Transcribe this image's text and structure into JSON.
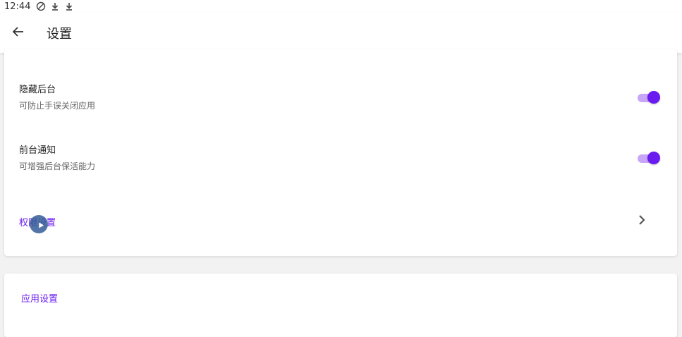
{
  "status_bar": {
    "time": "12:44",
    "icons": [
      "no-sync-icon",
      "download-icon",
      "download-icon"
    ]
  },
  "app_bar": {
    "title": "设置",
    "back_icon": "arrow-back-icon"
  },
  "settings": {
    "hide_background": {
      "title": "隐藏后台",
      "subtitle": "可防止手误关闭应用",
      "enabled": true
    },
    "foreground_notification": {
      "title": "前台通知",
      "subtitle": "可增强后台保活能力",
      "enabled": true
    },
    "permission_settings": {
      "label": "权限设置"
    }
  },
  "app_settings_section": {
    "label": "应用设置"
  },
  "colors": {
    "accent": "#6a1bf0",
    "switch_track": "#c7a6f7",
    "background": "#f2f2f2"
  }
}
